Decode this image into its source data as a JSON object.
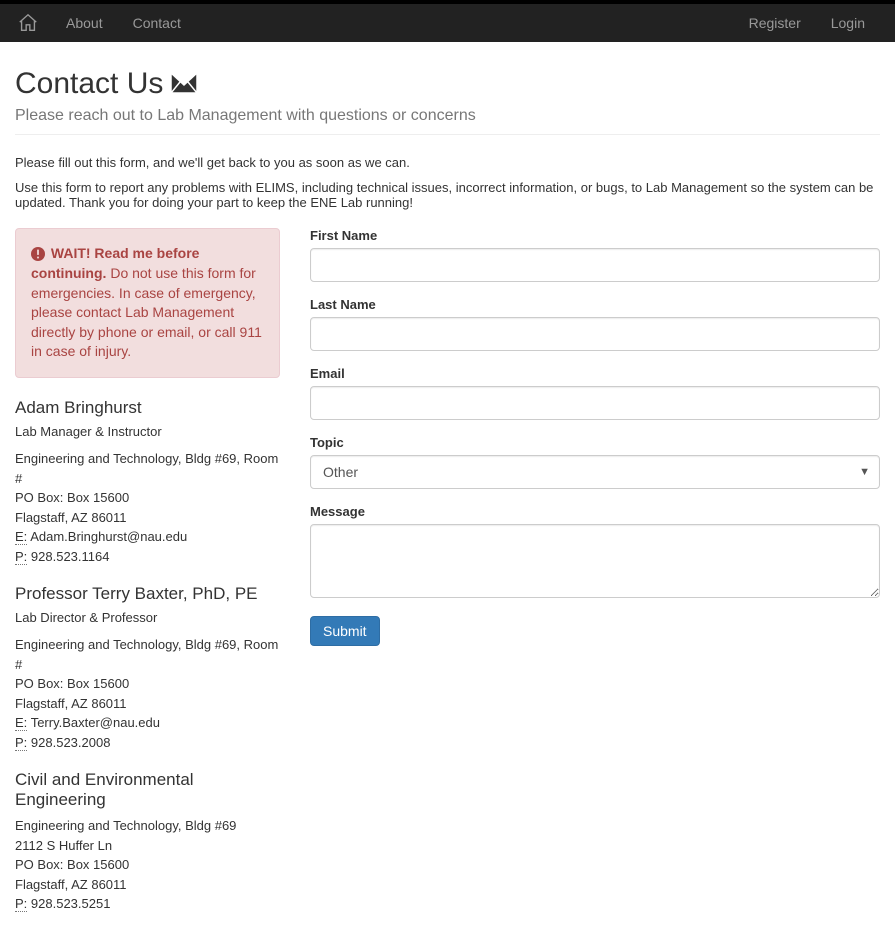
{
  "nav": {
    "about": "About",
    "contact": "Contact",
    "register": "Register",
    "login": "Login"
  },
  "header": {
    "title": "Contact Us",
    "subtitle": "Please reach out to Lab Management with questions or concerns"
  },
  "intro": {
    "line1": "Please fill out this form, and we'll get back to you as soon as we can.",
    "line2": "Use this form to report any problems with ELIMS, including technical issues, incorrect information, or bugs, to Lab Management so the system can be updated. Thank you for doing your part to keep the ENE Lab running!"
  },
  "alert": {
    "strong": "WAIT! Read me before continuing.",
    "body": "Do not use this form for emergencies. In case of emergency, please contact Lab Management directly by phone or email, or call 911 in case of injury."
  },
  "contacts": [
    {
      "name": "Adam Bringhurst",
      "role": "Lab Manager & Instructor",
      "addr1": "Engineering and Technology, Bldg #69, Room #",
      "addr2": "PO Box: Box 15600",
      "addr3": "Flagstaff, AZ 86011",
      "email_label": "E:",
      "email": "Adam.Bringhurst@nau.edu",
      "phone_label": "P:",
      "phone": "928.523.1164"
    },
    {
      "name": "Professor Terry Baxter, PhD, PE",
      "role": "Lab Director & Professor",
      "addr1": "Engineering and Technology, Bldg #69, Room #",
      "addr2": "PO Box: Box 15600",
      "addr3": "Flagstaff, AZ 86011",
      "email_label": "E:",
      "email": "Terry.Baxter@nau.edu",
      "phone_label": "P:",
      "phone": "928.523.2008"
    }
  ],
  "dept": {
    "name": "Civil and Environmental Engineering",
    "addr1": "Engineering and Technology, Bldg #69",
    "addr2": "2112 S Huffer Ln",
    "addr3": "PO Box: Box 15600",
    "addr4": "Flagstaff, AZ 86011",
    "phone_label": "P:",
    "phone": "928.523.5251"
  },
  "form": {
    "first_name": "First Name",
    "last_name": "Last Name",
    "email": "Email",
    "topic": "Topic",
    "topic_selected": "Other",
    "message": "Message",
    "submit": "Submit"
  }
}
